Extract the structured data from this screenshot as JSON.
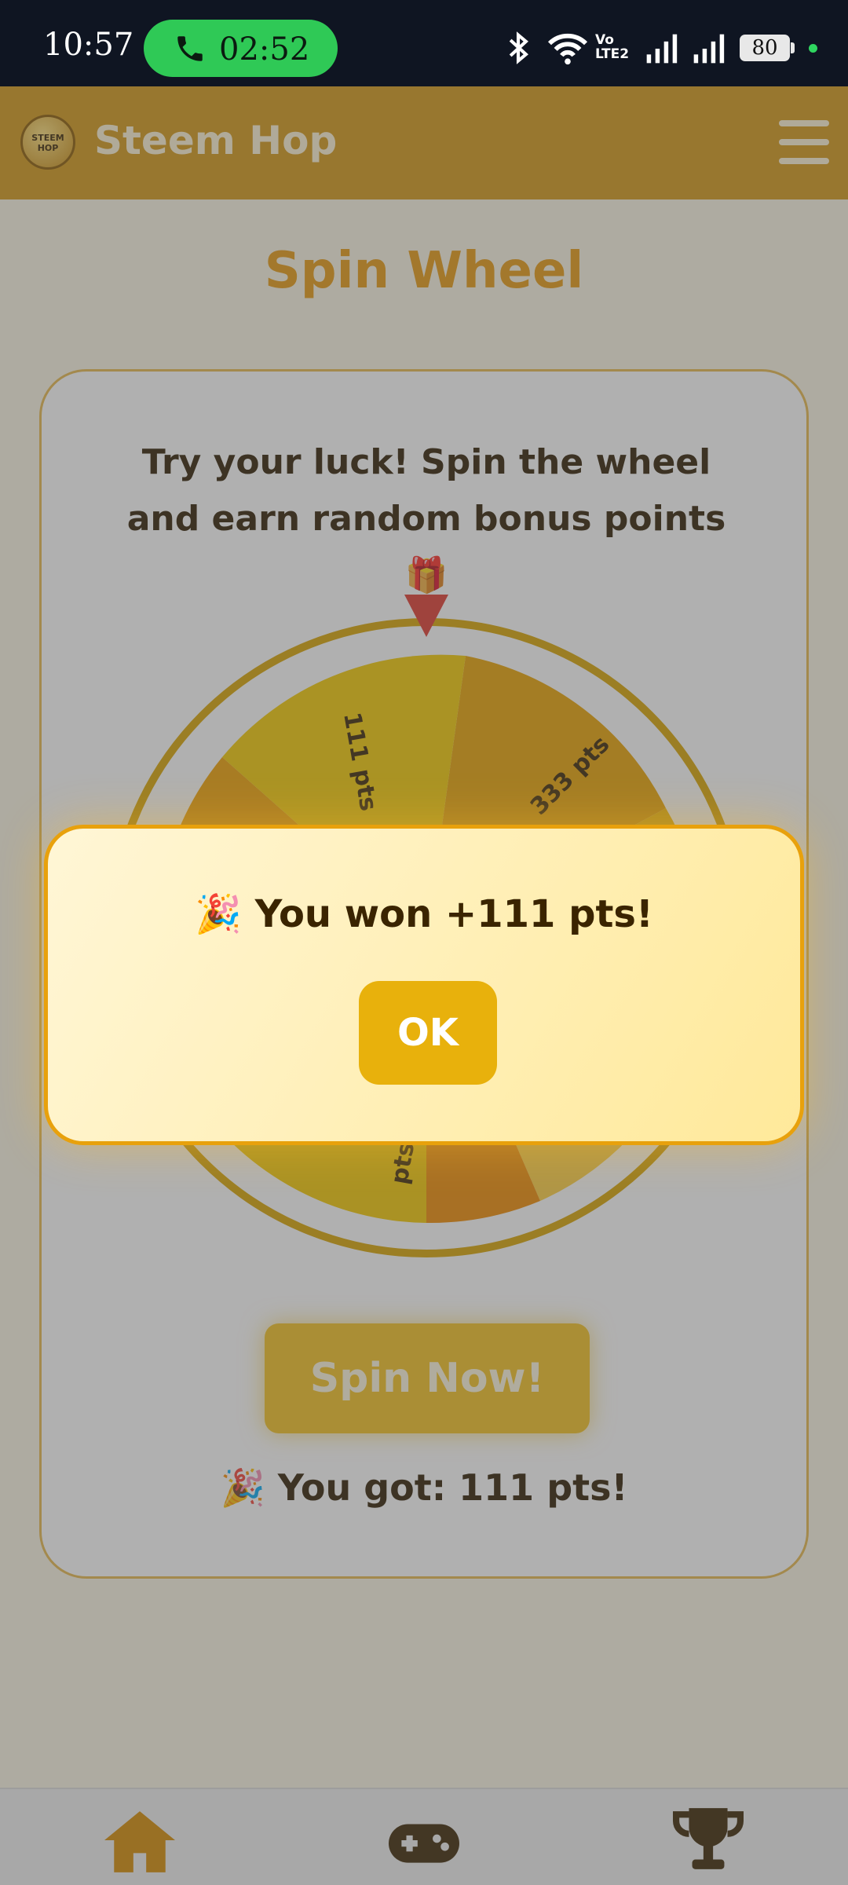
{
  "status_bar": {
    "time": "10:57",
    "call_timer": "02:52",
    "battery": "80",
    "network_label": "Vo LTE2"
  },
  "header": {
    "logo_text": "STEEM HOP",
    "title": "Steem Hop",
    "menu_icon": "hamburger-menu-icon"
  },
  "page": {
    "title": "Spin Wheel",
    "intro": "Try your luck! Spin the wheel and earn random bonus points 🎁",
    "spin_button": "Spin Now!",
    "result": "🎉 You got: 111 pts!"
  },
  "wheel": {
    "visible_labels": [
      "111 pts",
      "333 pts",
      "pts"
    ],
    "colors": [
      "#f4c900",
      "#eaa200",
      "#f7b500",
      "#ffcf40",
      "#f08a00"
    ]
  },
  "dialog": {
    "message": "🎉 You won +111 pts!",
    "ok_label": "OK"
  },
  "nav": {
    "items": [
      {
        "icon": "home-icon"
      },
      {
        "icon": "gamepad-icon"
      },
      {
        "icon": "trophy-icon"
      }
    ]
  },
  "colors": {
    "accent": "#e79a10",
    "header": "#d49714",
    "button": "#e8b10c"
  }
}
